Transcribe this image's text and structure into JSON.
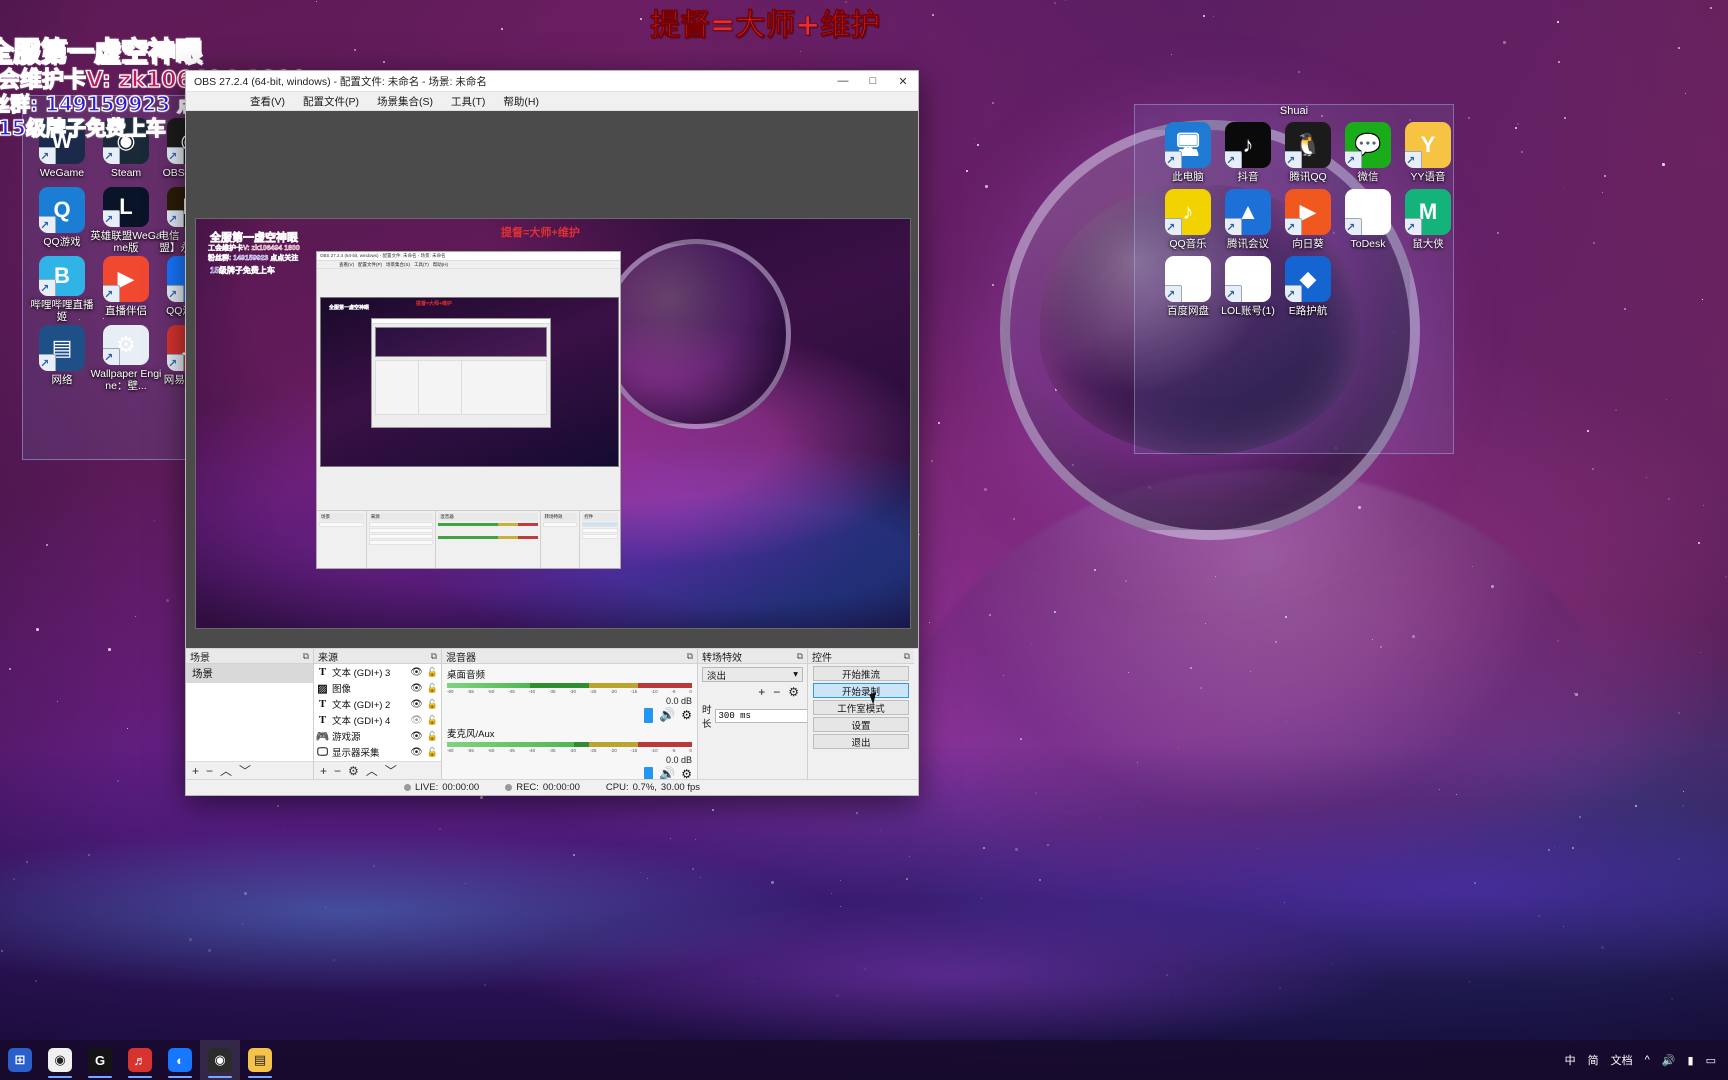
{
  "stream_overlay": {
    "top_banner": "提督=大师+维护",
    "line1": "全服第一虚空神眼",
    "line2": "工会维护卡V: zk106494 1800",
    "line3": "粉丝群: 149159923 点点关注",
    "line4": "15级牌子免费上车"
  },
  "desktop": {
    "left_icons": [
      {
        "label": "WeGame",
        "icon": "wegame-icon",
        "color": "#1b2a4a"
      },
      {
        "label": "Steam",
        "icon": "steam-icon",
        "color": "#1b2838"
      },
      {
        "label": "OBS Studio",
        "icon": "obs-icon",
        "color": "#1c1c1c"
      },
      {
        "label": "QQ游戏",
        "icon": "qq-games-icon",
        "color": "#1a7fd4"
      },
      {
        "label": "英雄联盟WeGame版",
        "icon": "lol-wegame-icon",
        "color": "#0a1428"
      },
      {
        "label": "电信【英雄联盟】永劫无...",
        "icon": "telecom-pop-icon",
        "color": "#2b1c07"
      },
      {
        "label": "哔哩哔哩直播姬",
        "icon": "bilibili-live-icon",
        "color": "#30b4e8"
      },
      {
        "label": "直播伴侣",
        "icon": "live-companion-icon",
        "color": "#f0492f"
      },
      {
        "label": "QQ浏览器",
        "icon": "qq-browser-icon",
        "color": "#1678ff"
      },
      {
        "label": "网络",
        "icon": "network-icon",
        "color": "#1e4f86"
      },
      {
        "label": "Wallpaper Engine：壁...",
        "icon": "wallpaper-engine-icon",
        "color": "#e8eef5"
      },
      {
        "label": "网易云音乐",
        "icon": "netease-music-icon",
        "color": "#d7332f"
      }
    ],
    "right_group_title": "Shuai",
    "right_icons": [
      {
        "label": "此电脑",
        "icon": "this-pc-icon",
        "color": "#1f7ad4"
      },
      {
        "label": "抖音",
        "icon": "douyin-icon",
        "color": "#0a0a0a"
      },
      {
        "label": "腾讯QQ",
        "icon": "tencent-qq-icon",
        "color": "#1b1b1b"
      },
      {
        "label": "微信",
        "icon": "wechat-icon",
        "color": "#1aad19"
      },
      {
        "label": "YY语音",
        "icon": "yy-voice-icon",
        "color": "#f6c343"
      },
      {
        "label": "QQ音乐",
        "icon": "qq-music-icon",
        "color": "#f2d200"
      },
      {
        "label": "腾讯会议",
        "icon": "tencent-meeting-icon",
        "color": "#1d70d8"
      },
      {
        "label": "向日葵",
        "icon": "sunflower-remote-icon",
        "color": "#f1581f"
      },
      {
        "label": "ToDesk",
        "icon": "todesk-icon",
        "color": "#ffffff"
      },
      {
        "label": "鼠大侠",
        "icon": "mouse-hero-icon",
        "color": "#13b37a"
      },
      {
        "label": "百度网盘",
        "icon": "baidu-netdisk-icon",
        "color": "#ffffff"
      },
      {
        "label": "LOL账号(1)",
        "icon": "text-document-icon",
        "color": "#ffffff"
      },
      {
        "label": "E路护航",
        "icon": "e-road-escort-icon",
        "color": "#1464d2"
      }
    ]
  },
  "obs": {
    "title": "OBS 27.2.4 (64-bit, windows) - 配置文件: 未命名 - 场景: 未命名",
    "window_buttons": {
      "minimize": "—",
      "maximize": "□",
      "close": "✕"
    },
    "menu": [
      "查看(V)",
      "配置文件(P)",
      "场景集合(S)",
      "工具(T)",
      "帮助(H)"
    ],
    "scenes": {
      "title": "场景",
      "float_icon": "undock-icon",
      "items": [
        "场景"
      ],
      "toolbar": [
        "+",
        "−",
        "︿",
        "﹀"
      ]
    },
    "sources": {
      "title": "来源",
      "float_icon": "undock-icon",
      "items": [
        {
          "name": "文本 (GDI+) 3",
          "type": "text",
          "visible": true,
          "locked": false
        },
        {
          "name": "图像",
          "type": "image",
          "visible": true,
          "locked": false
        },
        {
          "name": "文本 (GDI+) 2",
          "type": "text",
          "visible": true,
          "locked": false
        },
        {
          "name": "文本 (GDI+) 4",
          "type": "text",
          "visible": false,
          "locked": false
        },
        {
          "name": "游戏源",
          "type": "game",
          "visible": true,
          "locked": false
        },
        {
          "name": "显示器采集",
          "type": "display",
          "visible": true,
          "locked": false
        }
      ],
      "toolbar": [
        "+",
        "−",
        "⚙",
        "︿",
        "﹀"
      ]
    },
    "mixer": {
      "title": "混音器",
      "float_icon": "undock-icon",
      "channels": [
        {
          "name": "桌面音频",
          "db": "0.0 dB",
          "level_pct": 34,
          "muted": false
        },
        {
          "name": "麦克风/Aux",
          "db": "0.0 dB",
          "level_pct": 52,
          "muted": false
        }
      ],
      "tick_labels": [
        "-60",
        "-55",
        "-50",
        "-45",
        "-40",
        "-35",
        "-30",
        "-25",
        "-20",
        "-15",
        "-10",
        "-5",
        "0"
      ]
    },
    "transitions": {
      "title": "转场特效",
      "float_icon": "undock-icon",
      "selected": "淡出",
      "buttons": [
        "+",
        "−",
        "⚙"
      ],
      "duration_label": "时长",
      "duration_value": "300 ms"
    },
    "controls": {
      "title": "控件",
      "float_icon": "undock-icon",
      "buttons": [
        {
          "label": "开始推流",
          "active": false
        },
        {
          "label": "开始录制",
          "active": true
        },
        {
          "label": "工作室模式",
          "active": false
        },
        {
          "label": "设置",
          "active": false
        },
        {
          "label": "退出",
          "active": false
        }
      ]
    },
    "status_bar": {
      "live_label": "LIVE:",
      "live_time": "00:00:00",
      "rec_label": "REC:",
      "rec_time": "00:00:00",
      "cpu_label": "CPU:",
      "cpu_value": "0.7%,",
      "fps_value": "30.00 fps"
    }
  },
  "taskbar": {
    "items": [
      {
        "icon": "start-icon",
        "label": "⊞",
        "color": "#2b5fc9",
        "open": false
      },
      {
        "icon": "chrome-icon",
        "label": "◉",
        "color": "#f0f0f0",
        "open": true
      },
      {
        "icon": "wegame-taskbar-icon",
        "label": "G",
        "color": "#141414",
        "open": true
      },
      {
        "icon": "netease-music-taskbar-icon",
        "label": "♬",
        "color": "#d7332f",
        "open": true
      },
      {
        "icon": "qq-browser-taskbar-icon",
        "label": "◐",
        "color": "#1678ff",
        "open": true
      },
      {
        "icon": "obs-taskbar-icon",
        "label": "◉",
        "color": "#2b2b2b",
        "open": true,
        "active": true
      },
      {
        "icon": "file-explorer-icon",
        "label": "▤",
        "color": "#f5c24a",
        "open": true
      }
    ],
    "tray": {
      "ime_lang": "中",
      "ime_mode": "简",
      "label": "文档",
      "icons": [
        "^",
        "sound-icon",
        "network-icon",
        "notification-icon"
      ]
    }
  }
}
